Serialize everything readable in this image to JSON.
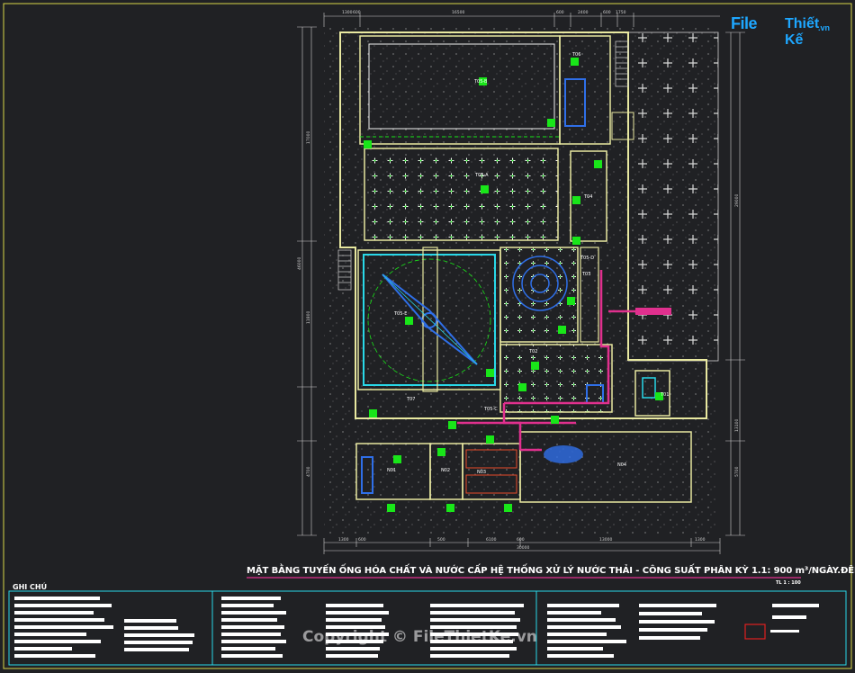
{
  "watermark": {
    "logo_part1": "File",
    "logo_part2": "Thiết Kế",
    "logo_part3": ".vn",
    "copyright": "Copyright © FileThietKe.vn"
  },
  "drawing": {
    "title": "MẶT BẰNG TUYẾN ỐNG HÓA CHẤT VÀ NƯỚC CẤP HỆ THỐNG XỬ LÝ NƯỚC THẢI - CÔNG SUẤT PHÂN KỲ 1.1: 900 m³/NGÀY.ĐÊM",
    "scale": "TL 1 : 100",
    "notes_heading": "GHI CHÚ"
  },
  "tank_labels": {
    "t05b": "T05-B",
    "t05a": "T05-A",
    "t05d": "T05-D",
    "t05e": "T05-E",
    "t06": "T06",
    "t04": "T04",
    "t03": "T03",
    "t02": "T02",
    "t01": "T01",
    "t07": "T07",
    "t05c": "T05-C",
    "n01": "N01",
    "n02": "N02",
    "n03": "N03",
    "n04": "N04"
  },
  "dimensions": {
    "top_1": "1300",
    "top_2": "600",
    "top_3": "16500",
    "top_4": "600",
    "top_5": "2400",
    "top_6": "600",
    "top_7": "1750",
    "bottom_1": "1300",
    "bottom_2": "600",
    "bottom_3": "6100",
    "bottom_4": "500",
    "bottom_5": "600",
    "bottom_6": "13000",
    "bottom_7": "1300",
    "bottom_total": "30000",
    "left_total": "46000",
    "left_1": "17000",
    "left_2": "11800",
    "left_3": "4700",
    "right_1": "29000",
    "right_2": "13100",
    "right_3": "5700"
  },
  "colors": {
    "background": "#202124",
    "wall": "#e8e8a0",
    "green_fill": "#19e619",
    "cyan": "#29d8e8",
    "magenta_pipe": "#e0308e",
    "blue_equipment": "#2f6fe8",
    "border": "#d8d848"
  }
}
